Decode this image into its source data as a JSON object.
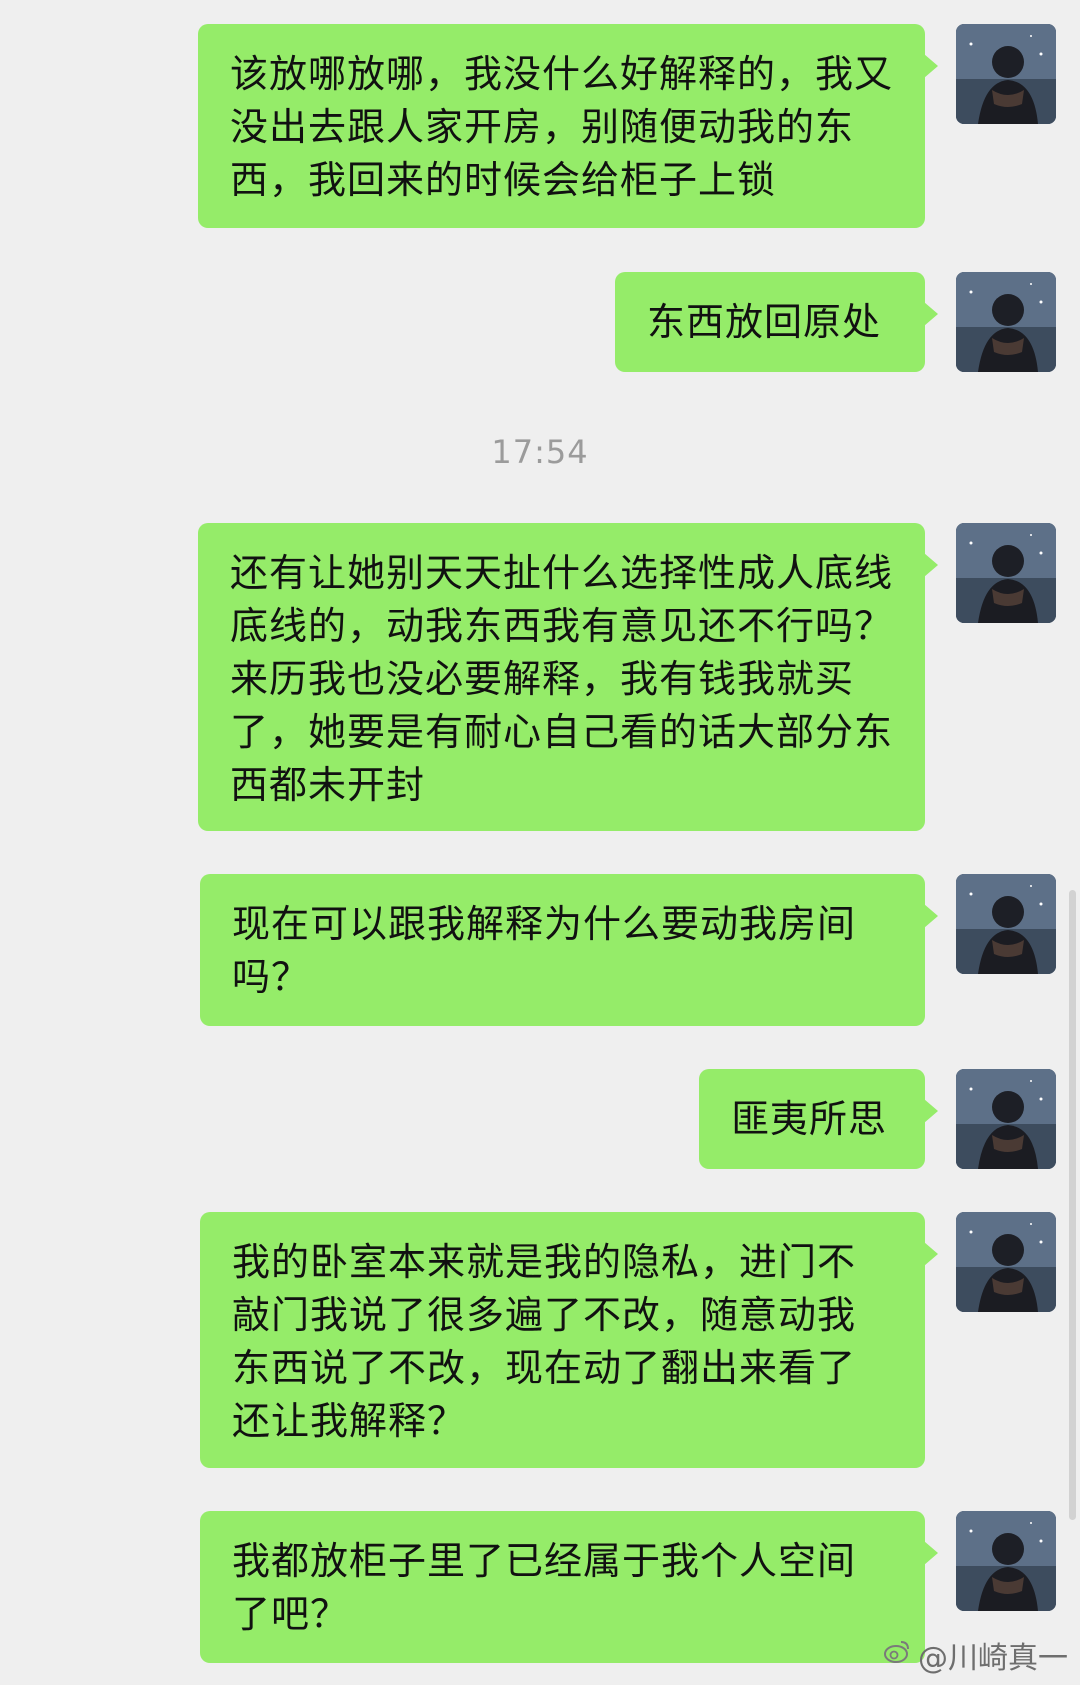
{
  "timestamp": "17:54",
  "messages": [
    {
      "text": "该放哪放哪，我没什么好解释的，我又没出去跟人家开房，别随便动我的东西，我回来的时候会给柜子上锁"
    },
    {
      "text": "东西放回原处"
    },
    {
      "text": "还有让她别天天扯什么选择性成人底线底线的，动我东西我有意见还不行吗？来历我也没必要解释，我有钱我就买了，她要是有耐心自己看的话大部分东西都未开封"
    },
    {
      "text": "现在可以跟我解释为什么要动我房间吗？"
    },
    {
      "text": "匪夷所思"
    },
    {
      "text": "我的卧室本来就是我的隐私，进门不敲门我说了很多遍了不改，随意动我东西说了不改，现在动了翻出来看了还让我解释？"
    },
    {
      "text": "我都放柜子里了已经属于我个人空间了吧？"
    }
  ],
  "watermark": {
    "icon": "weibo-icon",
    "text": "@川崎真一"
  },
  "colors": {
    "background": "#efefef",
    "bubble": "#95ec69",
    "timestamp": "#9b9b9b"
  }
}
